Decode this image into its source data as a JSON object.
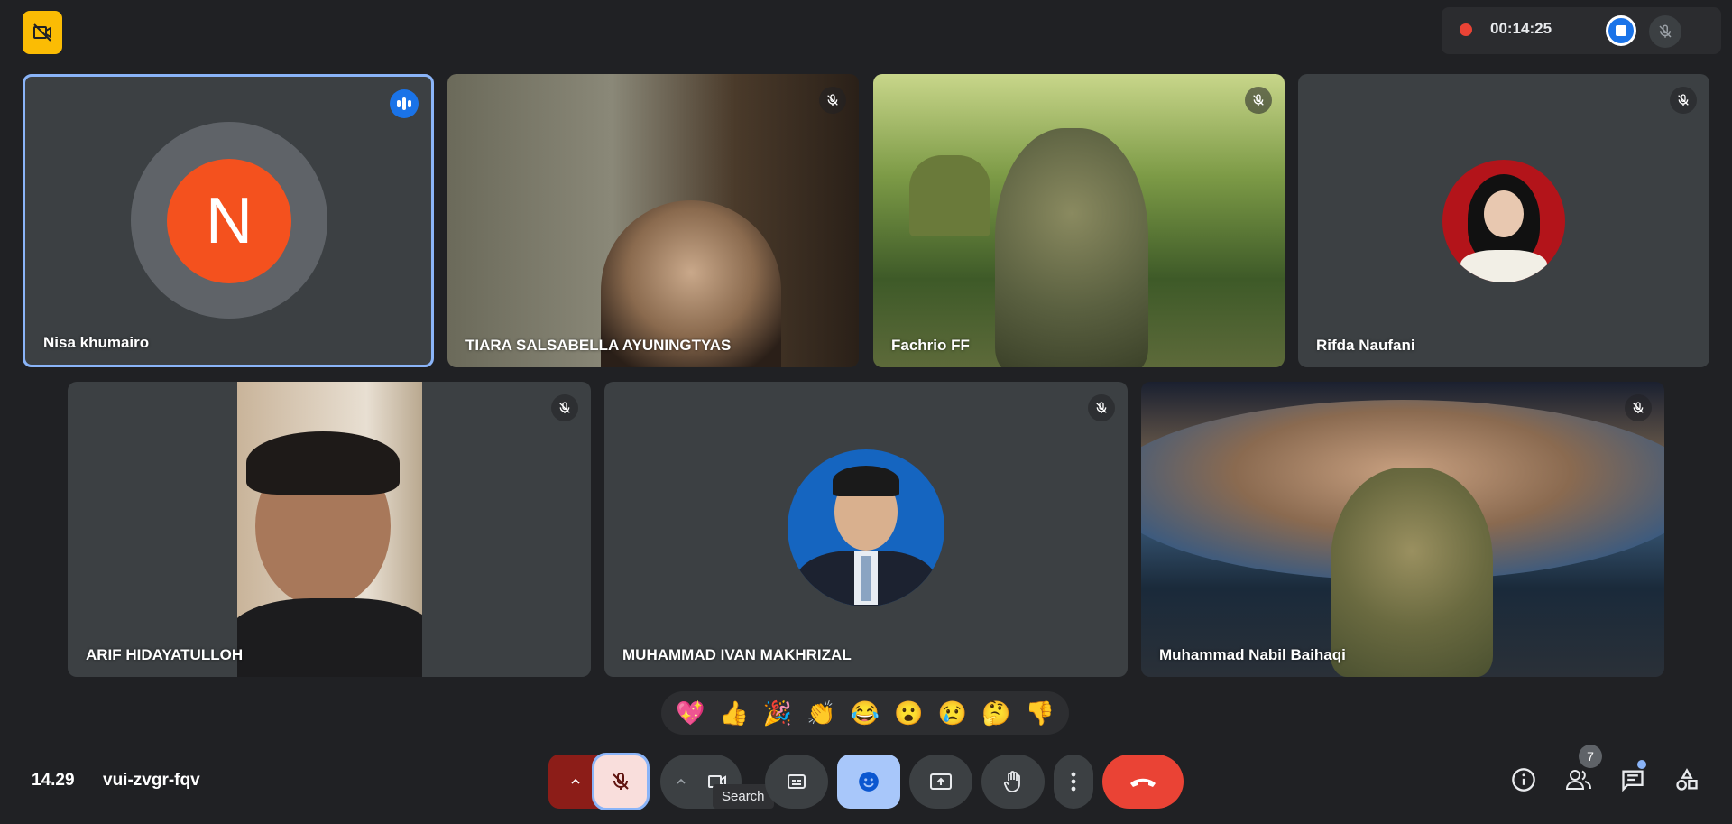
{
  "recording": {
    "timer": "00:14:25",
    "indicator_color": "#ea4335"
  },
  "participants": [
    {
      "name": "Nisa khumairo",
      "initial": "N",
      "avatar_color": "#f4511e",
      "speaking": true
    },
    {
      "name": "TIARA SALSABELLA AYUNINGTYAS",
      "muted": true
    },
    {
      "name": "Fachrio FF",
      "muted": true
    },
    {
      "name": "Rifda Naufani",
      "muted": true
    },
    {
      "name": "ARIF HIDAYATULLOH",
      "muted": true
    },
    {
      "name": "MUHAMMAD IVAN MAKHRIZAL",
      "muted": true
    },
    {
      "name": "Muhammad Nabil Baihaqi",
      "muted": true
    }
  ],
  "reactions": [
    "💖",
    "👍",
    "🎉",
    "👏",
    "😂",
    "😮",
    "😢",
    "🤔",
    "👎"
  ],
  "footer": {
    "time": "14.29",
    "meeting_code": "vui-zvgr-fqv"
  },
  "tooltip": "Search",
  "people_count": "7",
  "colors": {
    "accent": "#1a73e8",
    "end_call": "#ea4335",
    "muted_mic_bg": "#f9dedc",
    "active_reaction_bg": "#a8c7fa"
  }
}
